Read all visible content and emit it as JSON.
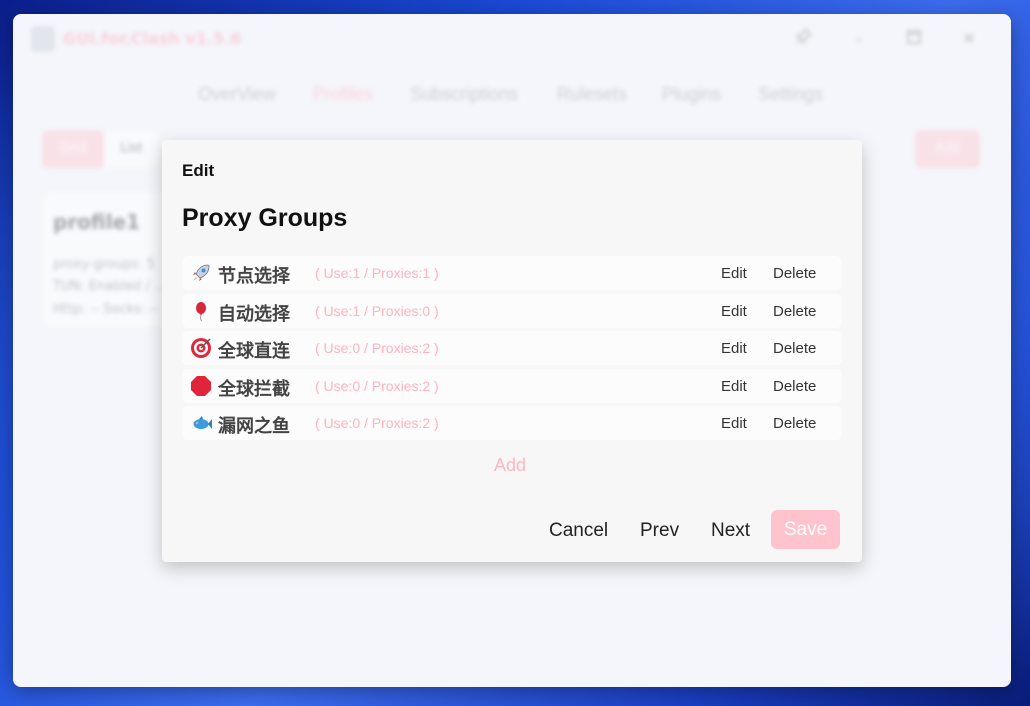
{
  "app": {
    "title": "GUI.for.Clash v1.5.6",
    "nav": [
      "OverView",
      "Profiles",
      "Subscriptions",
      "Rulesets",
      "Plugins",
      "Settings"
    ],
    "active_nav": "Profiles",
    "toolbar": {
      "left_primary": "Grid",
      "left_secondary": "List",
      "right_primary": "Add"
    },
    "profile_card": {
      "name": "profile1",
      "lines": [
        "proxy-groups: 5",
        "TUN: Enabled / ...",
        "Http: -- Socks: --"
      ]
    }
  },
  "modal": {
    "title": "Edit",
    "section_title": "Proxy Groups",
    "groups": [
      {
        "icon": "rocket-icon",
        "name": "节点选择",
        "stats": "( Use:1 / Proxies:1 )",
        "edit": "Edit",
        "delete": "Delete"
      },
      {
        "icon": "balloon-icon",
        "name": "自动选择",
        "stats": "( Use:1 / Proxies:0 )",
        "edit": "Edit",
        "delete": "Delete"
      },
      {
        "icon": "target-icon",
        "name": "全球直连",
        "stats": "( Use:0 / Proxies:2 )",
        "edit": "Edit",
        "delete": "Delete"
      },
      {
        "icon": "stop-sign-icon",
        "name": "全球拦截",
        "stats": "( Use:0 / Proxies:2 )",
        "edit": "Edit",
        "delete": "Delete"
      },
      {
        "icon": "fish-icon",
        "name": "漏网之鱼",
        "stats": "( Use:0 / Proxies:2 )",
        "edit": "Edit",
        "delete": "Delete"
      }
    ],
    "add_label": "Add",
    "footer": {
      "cancel": "Cancel",
      "prev": "Prev",
      "next": "Next",
      "save": "Save"
    }
  }
}
